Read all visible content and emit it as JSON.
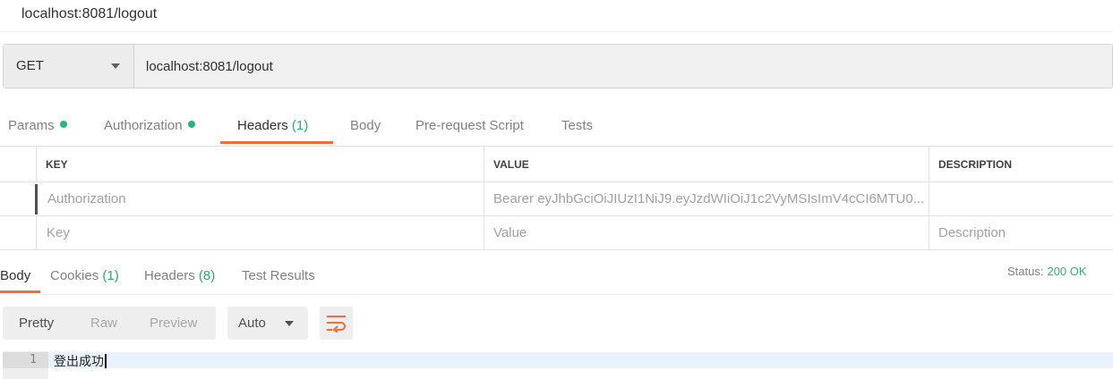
{
  "title": "localhost:8081/logout",
  "request": {
    "method": "GET",
    "url": "localhost:8081/logout"
  },
  "request_tabs": {
    "params": "Params",
    "authorization": "Authorization",
    "headers": "Headers",
    "headers_count": "(1)",
    "body": "Body",
    "prerequest": "Pre-request Script",
    "tests": "Tests"
  },
  "headers_table": {
    "columns": {
      "key": "KEY",
      "value": "VALUE",
      "description": "DESCRIPTION"
    },
    "rows": [
      {
        "key": "Authorization",
        "value": "Bearer eyJhbGciOiJIUzI1NiJ9.eyJzdWIiOiJ1c2VyMSIsImV4cCI6MTU0...",
        "description": ""
      }
    ],
    "placeholders": {
      "key": "Key",
      "value": "Value",
      "description": "Description"
    }
  },
  "response_tabs": {
    "body": "Body",
    "cookies": "Cookies",
    "cookies_count": "(1)",
    "headers": "Headers",
    "headers_count": "(8)",
    "test_results": "Test Results"
  },
  "status": {
    "label": "Status:",
    "value": "200 OK"
  },
  "view_modes": {
    "pretty": "Pretty",
    "raw": "Raw",
    "preview": "Preview"
  },
  "format": "Auto",
  "editor": {
    "line_number": "1",
    "content": "登出成功"
  },
  "colors": {
    "accent": "#f26b3a",
    "success": "#26b47f"
  },
  "icons": {
    "wrap": "wrap-lines-icon",
    "caret": "chevron-down-icon",
    "status_dot": "dot-icon"
  }
}
